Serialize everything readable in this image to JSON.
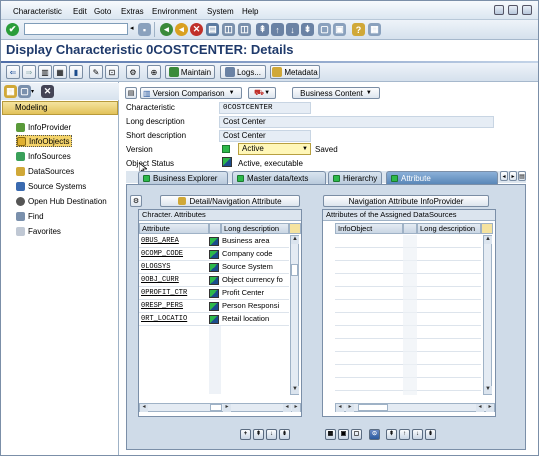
{
  "menubar": {
    "items": [
      "Characteristic",
      "Edit",
      "Goto",
      "Extras",
      "Environment",
      "System",
      "Help"
    ]
  },
  "toolbar1": {
    "command_field_value": ""
  },
  "title": "Display Characteristic 0COSTCENTER: Details",
  "toolbar2": {
    "maintain_label": "Maintain",
    "logs_label": "Logs...",
    "metadata_label": "Metadata"
  },
  "left_pane": {
    "header_label": "Modeling",
    "items": [
      {
        "label": "InfoProvider",
        "icon": "infoprovider-icon",
        "selected": false
      },
      {
        "label": "InfoObjects",
        "icon": "infoobject-icon",
        "selected": true
      },
      {
        "label": "InfoSources",
        "icon": "infosource-icon",
        "selected": false
      },
      {
        "label": "DataSources",
        "icon": "datasource-icon",
        "selected": false
      },
      {
        "label": "Source Systems",
        "icon": "source-system-icon",
        "selected": false
      },
      {
        "label": "Open Hub Destination",
        "icon": "open-hub-icon",
        "selected": false
      },
      {
        "label": "Find",
        "icon": "find-icon",
        "selected": false
      },
      {
        "label": "Favorites",
        "icon": "favorites-icon",
        "selected": false
      }
    ]
  },
  "header_buttons": {
    "version_comparison_label": "Version Comparison",
    "business_content_label": "Business Content"
  },
  "details": {
    "characteristic_label": "Characteristic",
    "characteristic_value": "0COSTCENTER",
    "long_desc_label": "Long description",
    "long_desc_value": "Cost Center",
    "short_desc_label": "Short description",
    "short_desc_value": "Cost Center",
    "version_label": "Version",
    "version_value": "Active",
    "version_status": "Saved",
    "object_status_label": "Object Status",
    "object_status_value": "Active, executable"
  },
  "tabs": [
    {
      "label": "Business Explorer",
      "active": false
    },
    {
      "label": "Master data/texts",
      "active": false
    },
    {
      "label": "Hierarchy",
      "active": false
    },
    {
      "label": "Attribute",
      "active": true
    }
  ],
  "attributes_panel": {
    "detail_button_label": "Detail/Navigation Attribute",
    "group_title": "Chracter. Attributes",
    "col_attribute": "Attribute",
    "col_long_desc": "Long description",
    "rows": [
      {
        "attribute": "0BUS_AREA",
        "description": "Business area"
      },
      {
        "attribute": "0COMP_CODE",
        "description": "Company code"
      },
      {
        "attribute": "0LOGSYS",
        "description": "Source System"
      },
      {
        "attribute": "0OBJ_CURR",
        "description": "Object currency fo"
      },
      {
        "attribute": "0PROFIT_CTR",
        "description": "Profit Center"
      },
      {
        "attribute": "0RESP_PERS",
        "description": "Person Responsi"
      },
      {
        "attribute": "0RT_LOCATIO",
        "description": "Retail location"
      }
    ]
  },
  "nav_panel": {
    "button_label": "Navigation Attribute InfoProvider",
    "group_title": "Attributes of the Assigned DataSources",
    "col_infoobject": "InfoObject",
    "col_long_desc": "Long description"
  },
  "colors": {
    "title": "#1f3a6b",
    "active_green": "#2db84a",
    "selected_nav": "#f5d46a",
    "version_field": "#fff7b8"
  }
}
